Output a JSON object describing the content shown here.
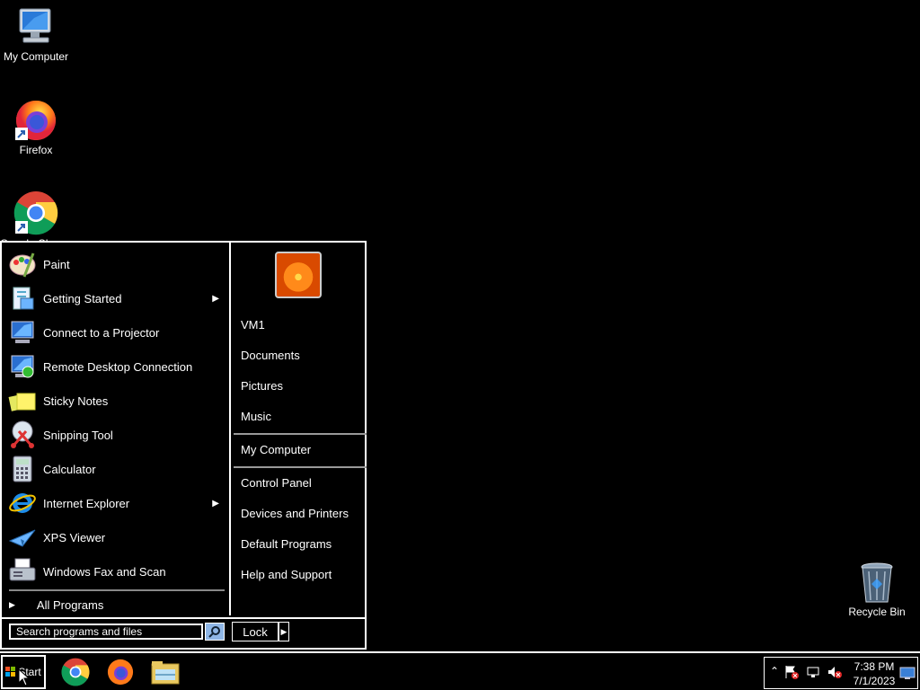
{
  "desktop": {
    "icons": [
      {
        "label": "My Computer",
        "icon": "computer-icon"
      },
      {
        "label": "Firefox",
        "icon": "firefox-icon"
      },
      {
        "label": "Google Chrome",
        "icon": "chrome-icon"
      },
      {
        "label": "Recycle Bin",
        "icon": "recycle-bin-icon"
      }
    ]
  },
  "start_menu": {
    "programs": [
      {
        "label": "Paint",
        "icon": "paint-icon",
        "submenu": false
      },
      {
        "label": "Getting Started",
        "icon": "getting-started-icon",
        "submenu": true
      },
      {
        "label": "Connect to a Projector",
        "icon": "projector-icon",
        "submenu": false
      },
      {
        "label": "Remote Desktop Connection",
        "icon": "remote-desktop-icon",
        "submenu": false
      },
      {
        "label": "Sticky Notes",
        "icon": "sticky-notes-icon",
        "submenu": false
      },
      {
        "label": "Snipping Tool",
        "icon": "snipping-tool-icon",
        "submenu": false
      },
      {
        "label": "Calculator",
        "icon": "calculator-icon",
        "submenu": false
      },
      {
        "label": "Internet Explorer",
        "icon": "internet-explorer-icon",
        "submenu": true
      },
      {
        "label": "XPS Viewer",
        "icon": "xps-viewer-icon",
        "submenu": false
      },
      {
        "label": "Windows Fax and Scan",
        "icon": "fax-scan-icon",
        "submenu": false
      }
    ],
    "all_programs": "All Programs",
    "search_placeholder": "Search programs and files",
    "right_items": {
      "user": "VM1",
      "documents": "Documents",
      "pictures": "Pictures",
      "music": "Music",
      "my_computer": "My Computer",
      "control_panel": "Control Panel",
      "devices_printers": "Devices and Printers",
      "default_programs": "Default Programs",
      "help_support": "Help and Support"
    },
    "lock_label": "Lock"
  },
  "taskbar": {
    "start_label": "Start",
    "pinned": [
      "chrome-icon",
      "firefox-icon",
      "file-explorer-icon"
    ],
    "clock_time": "7:38 PM",
    "clock_date": "7/1/2023"
  }
}
